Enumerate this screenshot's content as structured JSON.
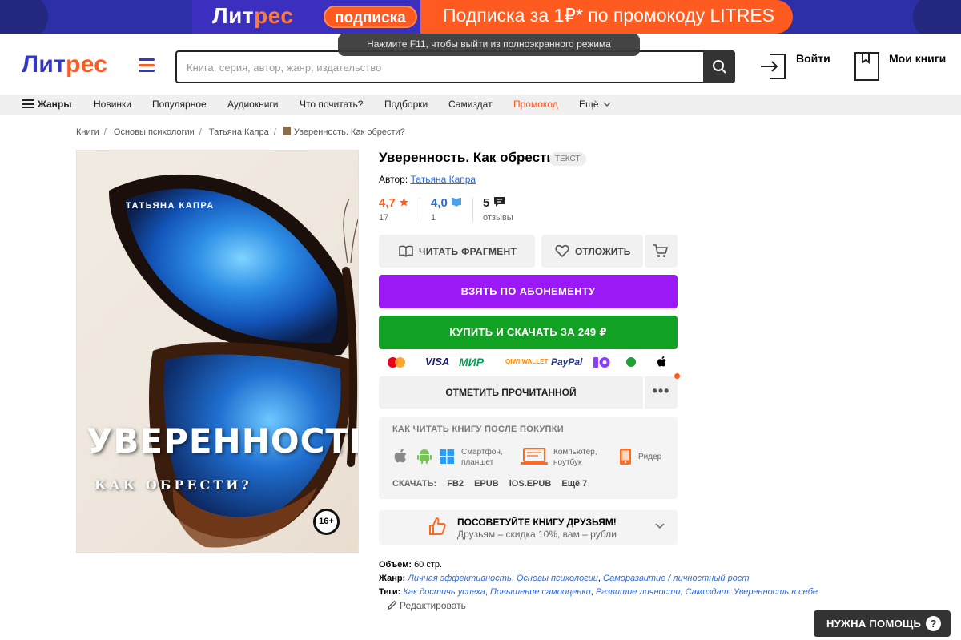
{
  "promo": {
    "logo_part1": "Лит",
    "logo_part2": "рес",
    "tag": "подписка",
    "text": "Подписка за 1₽* по промокоду LITRES"
  },
  "fullscreen_tip": "Нажмите F11, чтобы выйти из полноэкранного режима",
  "header": {
    "brand_part1": "Лит",
    "brand_part2": "рес",
    "search_placeholder": "Книга, серия, автор, жанр, издательство",
    "login_label": "Войти",
    "mybooks_label": "Мои книги"
  },
  "nav": {
    "genres": "Жанры",
    "items": [
      "Новинки",
      "Популярное",
      "Аудиокниги",
      "Что почитать?",
      "Подборки",
      "Самиздат",
      "Промокод",
      "Ещё"
    ]
  },
  "breadcrumbs": [
    "Книги",
    "Основы психологии",
    "Татьяна Капра",
    "Уверенность. Как обрести?"
  ],
  "cover": {
    "author": "ТАТЬЯНА КАПРА",
    "title": "УВЕРЕННОСТЬ",
    "subtitle": "КАК ОБРЕСТИ?",
    "age": "16+"
  },
  "book": {
    "title": "Уверенность. Как обрести?",
    "type": "ТЕКСТ",
    "author_label": "Автор:",
    "author": "Татьяна Капра",
    "rating_litres": "4,7",
    "rating_litres_count": "17",
    "rating_livelib": "4,0",
    "rating_livelib_count": "1",
    "reviews": "5",
    "reviews_label": "отзывы"
  },
  "buttons": {
    "read_fragment": "ЧИТАТЬ ФРАГМЕНТ",
    "later": "ОТЛОЖИТЬ",
    "subscribe": "ВЗЯТЬ ПО АБОНЕМЕНТУ",
    "buy": "КУПИТЬ И СКАЧАТЬ ЗА 249 ₽",
    "mark_read": "ОТМЕТИТЬ ПРОЧИТАННОЙ",
    "more": "•••"
  },
  "payments": {
    "visa": "VISA",
    "mir": "МИР",
    "qiwi": "QIWI WALLET",
    "paypal": "PayPal"
  },
  "howto": {
    "heading": "КАК ЧИТАТЬ КНИГУ ПОСЛЕ ПОКУПКИ",
    "phone": "Смартфон,\nпланшет",
    "computer": "Компьютер,\nноутбук",
    "reader": "Ридер",
    "download_label": "СКАЧАТЬ:",
    "formats": [
      "FB2",
      "EPUB",
      "iOS.EPUB",
      "Ещё 7"
    ]
  },
  "recommend": {
    "title": "ПОСОВЕТУЙТЕ КНИГУ ДРУЗЬЯМ!",
    "subtitle": "Друзьям – скидка 10%, вам – рубли"
  },
  "meta": {
    "volume_label": "Объем:",
    "volume": "60 стр.",
    "genre_label": "Жанр:",
    "genres": [
      "Личная эффективность",
      "Основы психологии",
      "Саморазвитие / личностный рост"
    ],
    "tags_label": "Теги:",
    "tags": [
      "Как достичь успеха",
      "Повышение самооценки",
      "Развитие личности",
      "Самиздат",
      "Уверенность в себе"
    ],
    "edit": "Редактировать"
  },
  "help": "НУЖНА ПОМОЩЬ",
  "colors": {
    "brand_blue": "#3338c4",
    "brand_orange": "#ff5a1f",
    "subscribe_purple": "#9b19f5",
    "buy_green": "#12a223"
  }
}
